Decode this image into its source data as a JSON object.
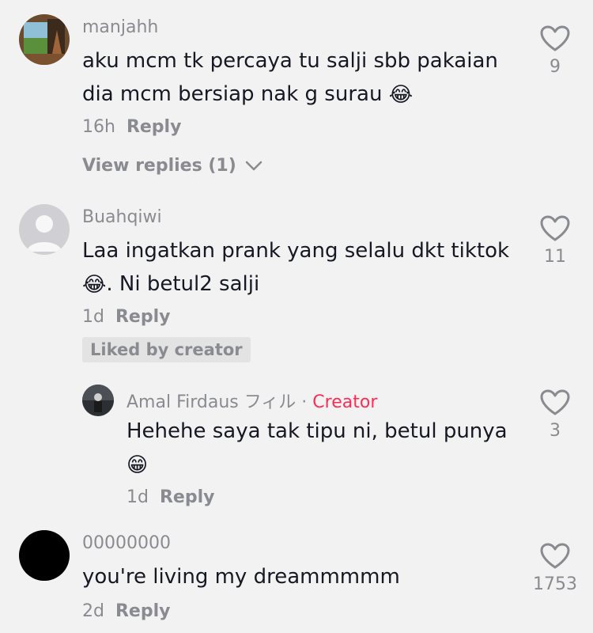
{
  "comments": [
    {
      "username": "manjahh",
      "text": "aku mcm tk percaya tu salji sbb pakaian dia mcm bersiap nak g surau",
      "emoji": "😂",
      "time": "16h",
      "reply_label": "Reply",
      "likes": "9",
      "view_replies": "View replies (1)"
    },
    {
      "username": "Buahqiwi",
      "text_line1": "Laa ingatkan prank yang selalu dkt tiktok",
      "text_line2": ". Ni betul2 salji",
      "emoji": "😂",
      "time": "1d",
      "reply_label": "Reply",
      "likes": "11",
      "badge": "Liked by creator"
    },
    {
      "username": "Amal Firdaus フィル",
      "separator": "·",
      "creator_label": "Creator",
      "text": "Hehehe saya tak tipu ni, betul punya",
      "emoji": "😁",
      "time": "1d",
      "reply_label": "Reply",
      "likes": "3"
    },
    {
      "username": "00000000",
      "text": "you're living my dreammmmm",
      "time": "2d",
      "reply_label": "Reply",
      "likes": "1753"
    }
  ],
  "colors": {
    "background": "#f2f2f2",
    "text": "#161823",
    "secondary": "#8a8b91",
    "creator": "#fe2c55",
    "badge_bg": "#e3e3e3"
  }
}
